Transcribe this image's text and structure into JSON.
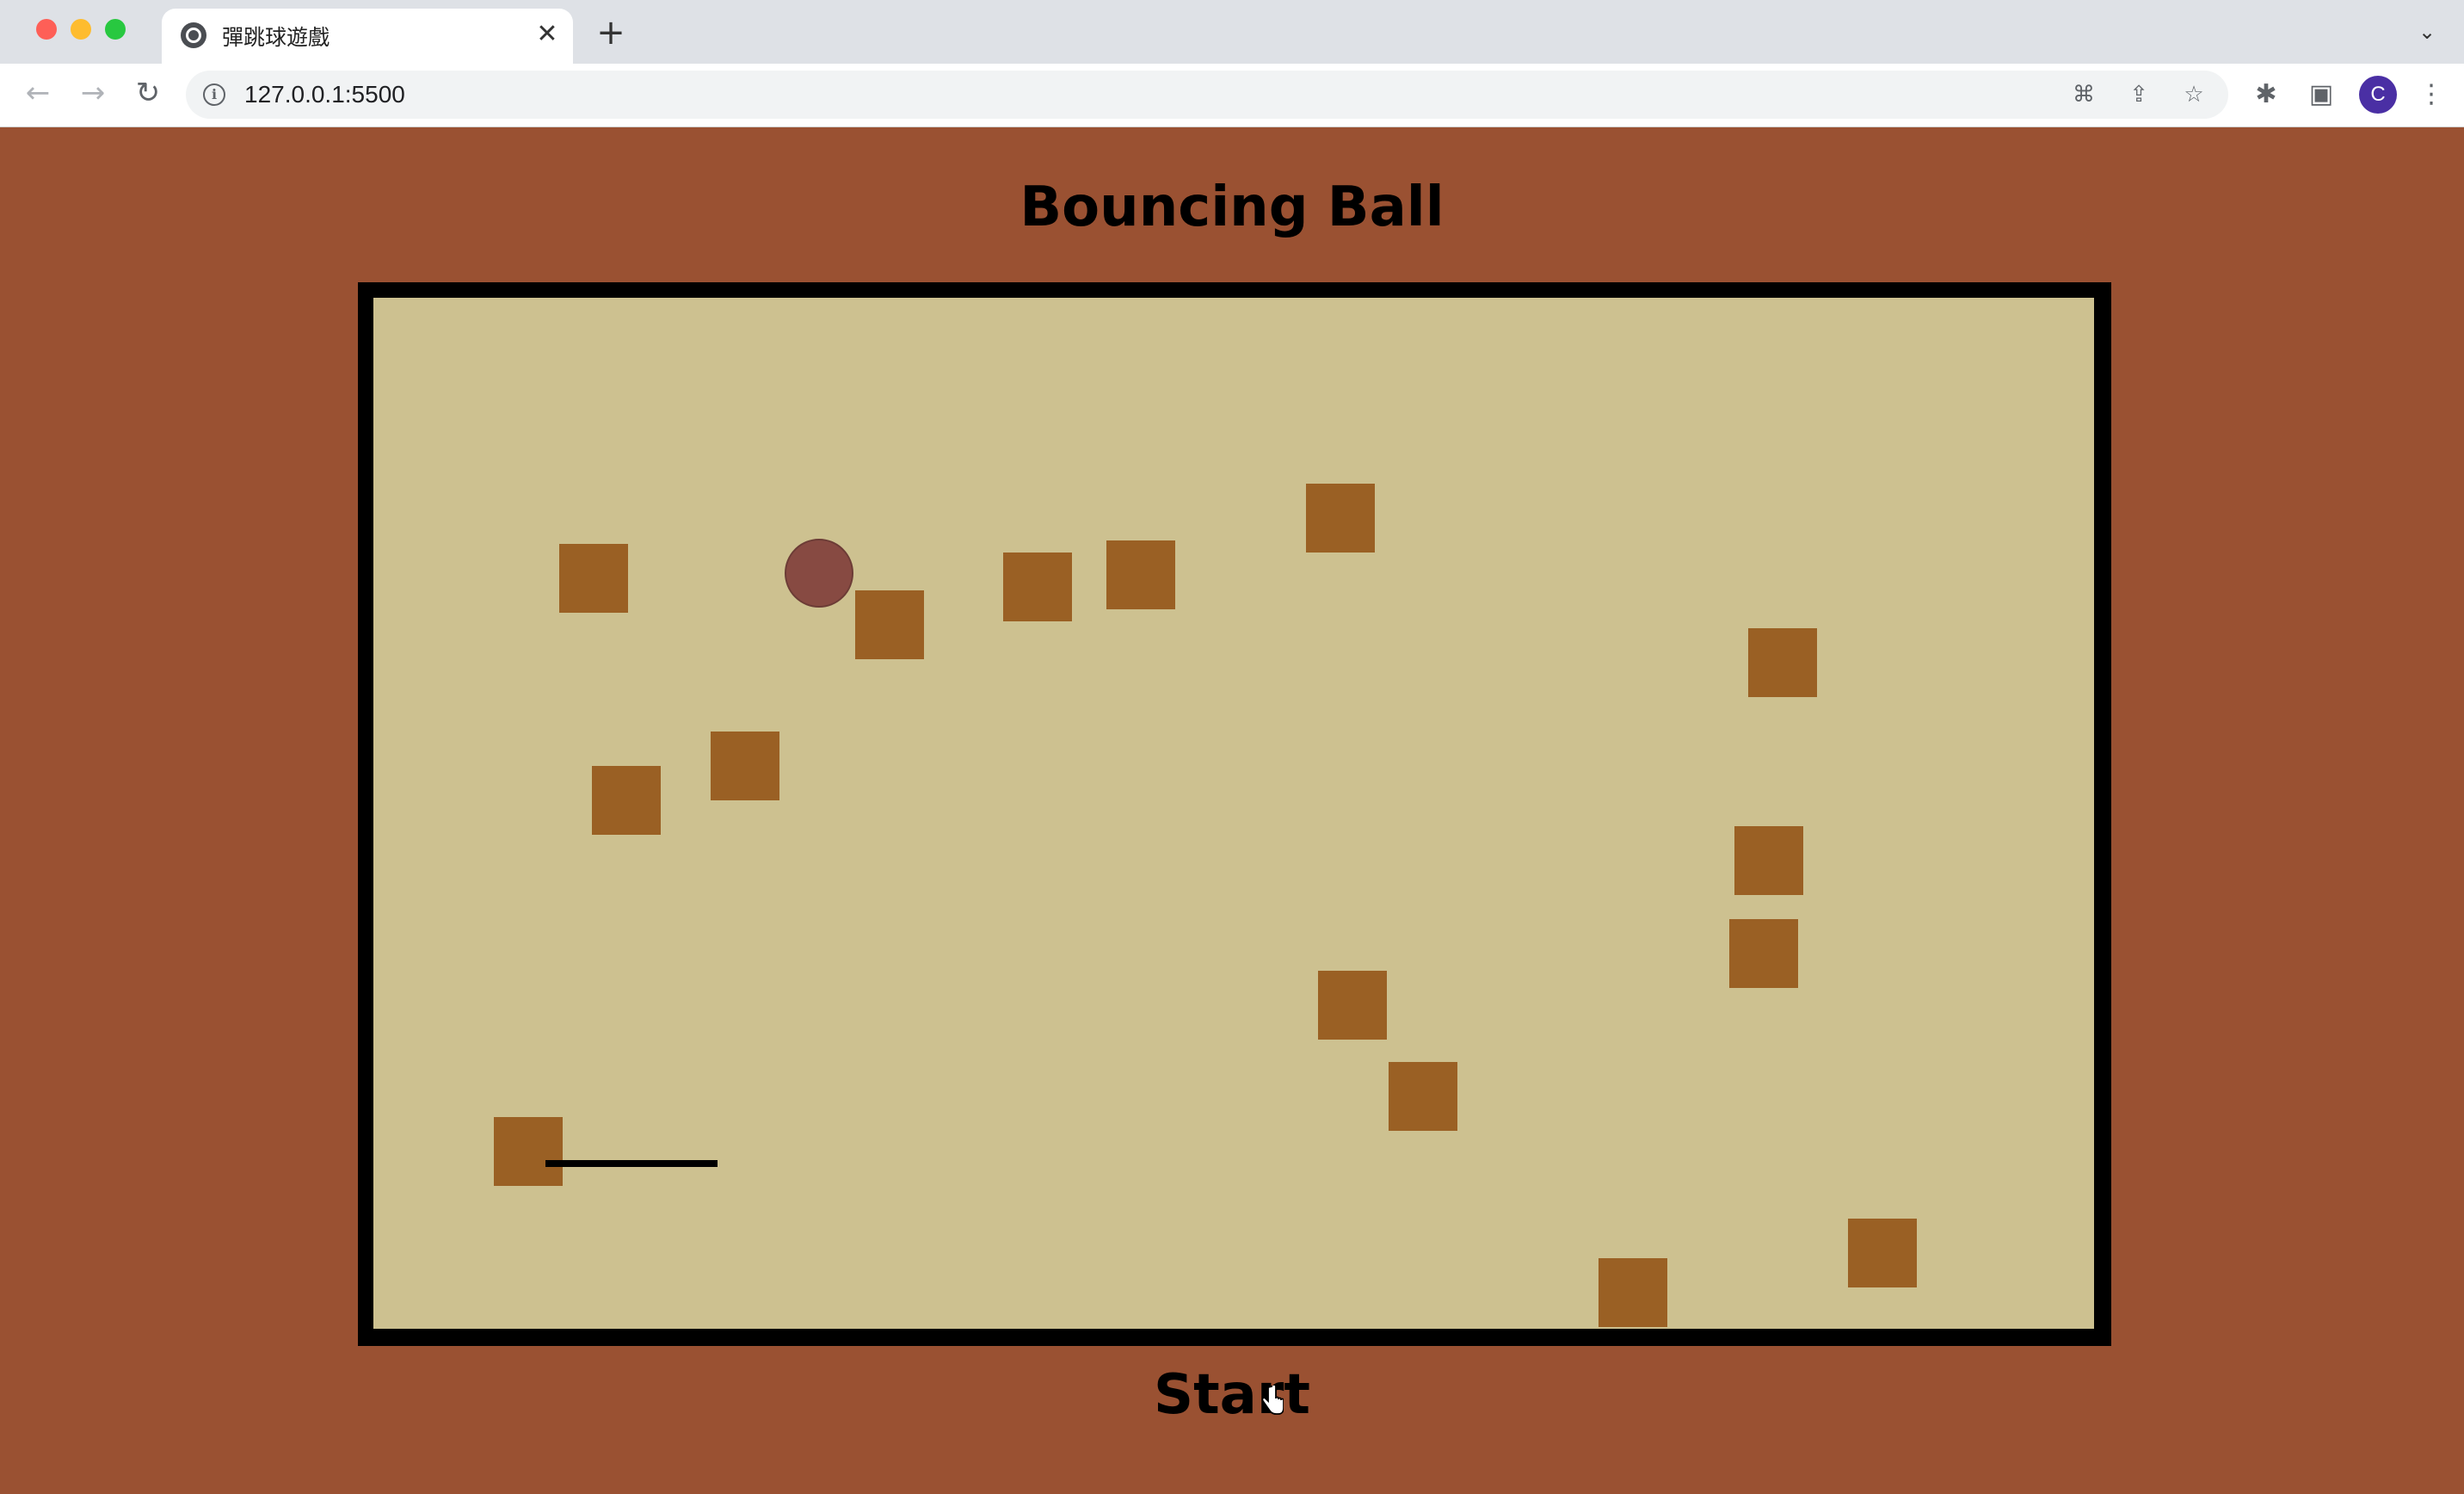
{
  "browser": {
    "tab_title": "彈跳球遊戲",
    "url": "127.0.0.1:5500",
    "profile_initial": "C"
  },
  "page": {
    "title": "Bouncing Ball",
    "start_label": "Start"
  },
  "colors": {
    "page_background": "#9a5132",
    "field_background": "#cdc190",
    "block": "#9a6024",
    "ball": "#874a42",
    "paddle": "#000000",
    "border": "#000000"
  },
  "icons": {
    "back": "arrow-left-icon",
    "forward": "arrow-right-icon",
    "reload": "reload-icon",
    "site_info": "info-icon",
    "translate": "translate-icon",
    "share": "share-icon",
    "bookmark": "star-icon",
    "extensions": "puzzle-icon",
    "side_panel": "side-panel-icon",
    "menu": "kebab-menu-icon"
  }
}
